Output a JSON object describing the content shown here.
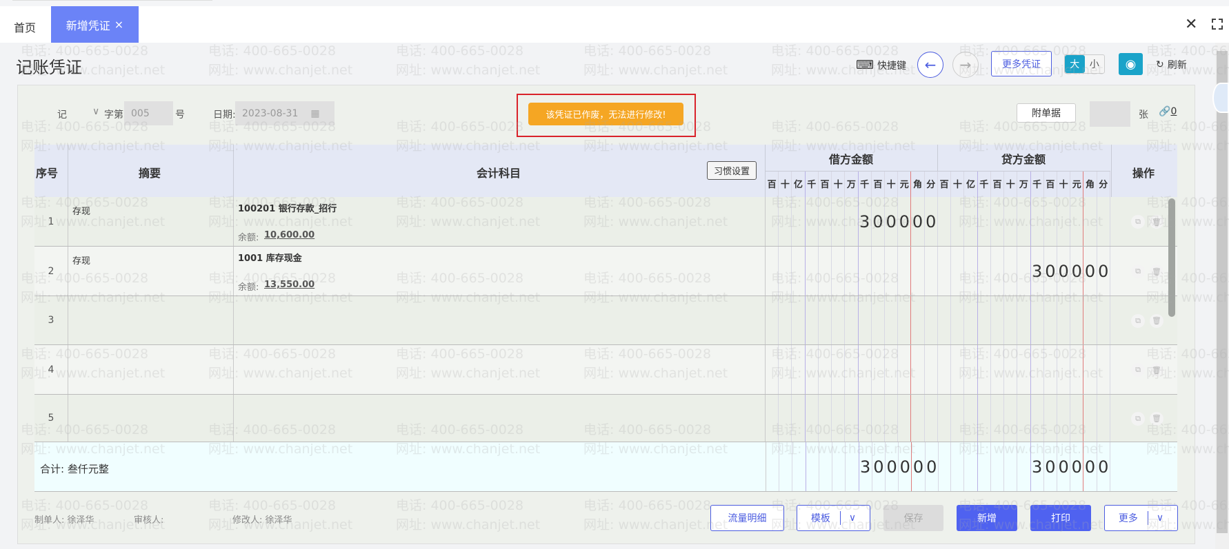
{
  "tabs": {
    "home": "首页",
    "active": "新增凭证",
    "active_close": "×"
  },
  "title": "记账凭证",
  "toolbar": {
    "shortcut": "快捷键",
    "prev": "←",
    "next": "→",
    "more_vouchers": "更多凭证",
    "size_big": "大",
    "size_small": "小",
    "refresh": "刷新"
  },
  "meta": {
    "word": "记",
    "word_label": "字第",
    "number": "005",
    "number_suffix": "号",
    "date_label": "日期:",
    "date": "2023-08-31",
    "attach_label": "附单据",
    "attach_count": "",
    "attach_unit": "张",
    "link_count": "0"
  },
  "warning": "该凭证已作废，无法进行修改!",
  "header": {
    "seq": "序号",
    "summary": "摘要",
    "account": "会计科目",
    "habit": "习惯设置",
    "debit": "借方金额",
    "credit": "贷方金额",
    "ops": "操作",
    "units": [
      "百",
      "十",
      "亿",
      "千",
      "百",
      "十",
      "万",
      "千",
      "百",
      "十",
      "元",
      "角",
      "分"
    ]
  },
  "rows": [
    {
      "seq": "1",
      "summary": "存现",
      "account": "100201 银行存款_招行",
      "balance_label": "余额:",
      "balance": "10,600.00",
      "debit": "300000",
      "credit": ""
    },
    {
      "seq": "2",
      "summary": "存现",
      "account": "1001 库存现金",
      "balance_label": "余额:",
      "balance": "13,550.00",
      "debit": "",
      "credit": "300000"
    },
    {
      "seq": "3",
      "summary": "",
      "account": "",
      "balance_label": "",
      "balance": "",
      "debit": "",
      "credit": ""
    },
    {
      "seq": "4",
      "summary": "",
      "account": "",
      "balance_label": "",
      "balance": "",
      "debit": "",
      "credit": ""
    },
    {
      "seq": "5",
      "summary": "",
      "account": "",
      "balance_label": "",
      "balance": "",
      "debit": "",
      "credit": ""
    }
  ],
  "total": {
    "label": "合计: 叁仟元整",
    "debit": "300000",
    "credit": "300000"
  },
  "footer": {
    "maker": "制单人: 徐泽华",
    "auditor": "审核人:",
    "modifier": "修改人: 徐泽华"
  },
  "buttons": {
    "flow": "流量明细",
    "template": "模板",
    "save": "保存",
    "add": "新增",
    "print": "打印",
    "more": "更多"
  },
  "watermark": {
    "line1": "电话: 400-665-0028",
    "line2": "网址: www.chanjet.net"
  }
}
